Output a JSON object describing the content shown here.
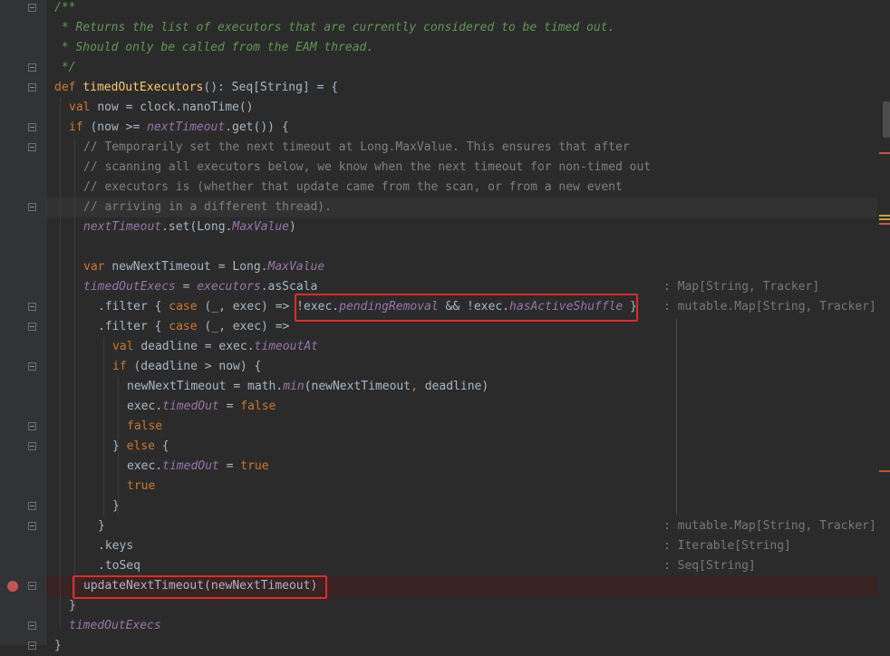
{
  "editor": {
    "language": "Scala",
    "accent_colors": {
      "breakpoint": "#c75450",
      "highlight_box": "#e02b2b",
      "keyword": "#cc7832",
      "function": "#ffc66d",
      "field": "#9876aa",
      "comment": "#808080",
      "doc_comment": "#629755"
    }
  },
  "lines": [
    {
      "tokens": [
        [
          "c-com",
          "/**"
        ]
      ]
    },
    {
      "tokens": [
        [
          "c-com",
          " * Returns the list of executors that are currently considered to be timed out."
        ]
      ]
    },
    {
      "tokens": [
        [
          "c-com",
          " * Should only be called from the EAM thread."
        ]
      ]
    },
    {
      "tokens": [
        [
          "c-com",
          " */"
        ]
      ]
    },
    {
      "tokens": [
        [
          "kw",
          "def "
        ],
        [
          "fn",
          "timedOutExecutors"
        ],
        [
          "",
          "(): Seq[String] = {"
        ]
      ]
    },
    {
      "tokens": [
        [
          "kw",
          "val "
        ],
        [
          "",
          "now = clock.nanoTime()"
        ]
      ]
    },
    {
      "tokens": [
        [
          "kw",
          "if "
        ],
        [
          "",
          "(now >= "
        ],
        [
          "fld",
          "nextTimeout"
        ],
        [
          "",
          ".get()) {"
        ]
      ]
    },
    {
      "tokens": [
        [
          "c-cmt",
          "// Temporarily set the next timeout at Long.MaxValue. This ensures that after"
        ]
      ]
    },
    {
      "tokens": [
        [
          "c-cmt",
          "// scanning all executors below, we know when the next timeout for non-timed out"
        ]
      ]
    },
    {
      "tokens": [
        [
          "c-cmt",
          "// executors is (whether that update came from the scan, or from a new event"
        ]
      ]
    },
    {
      "tokens": [
        [
          "c-cmt",
          "// arriving in a different thread)."
        ]
      ]
    },
    {
      "tokens": [
        [
          "fld",
          "nextTimeout"
        ],
        [
          "",
          ".set(Long."
        ],
        [
          "fld",
          "MaxValue"
        ],
        [
          "",
          ")"
        ]
      ]
    },
    {
      "tokens": []
    },
    {
      "tokens": [
        [
          "kw",
          "var "
        ],
        [
          "",
          "newNextTimeout = Long."
        ],
        [
          "fld",
          "MaxValue"
        ]
      ]
    },
    {
      "tokens": [
        [
          "fld",
          "timedOutExecs"
        ],
        [
          "",
          " = "
        ],
        [
          "fld",
          "executors"
        ],
        [
          "",
          ".asScala"
        ]
      ]
    },
    {
      "tokens": [
        [
          "",
          ".filter { "
        ],
        [
          "kw",
          "case "
        ],
        [
          "",
          "(_, exec) => "
        ],
        [
          "",
          "!exec."
        ],
        [
          "fld",
          "pendingRemoval"
        ],
        [
          "",
          " && !exec."
        ],
        [
          "fld",
          "hasActiveShuffle"
        ],
        [
          "",
          " }"
        ]
      ]
    },
    {
      "tokens": [
        [
          "",
          ".filter { "
        ],
        [
          "kw",
          "case "
        ],
        [
          "",
          "(_, exec) =>"
        ]
      ]
    },
    {
      "tokens": [
        [
          "kw",
          "val "
        ],
        [
          "",
          "deadline = exec."
        ],
        [
          "fld",
          "timeoutAt"
        ]
      ]
    },
    {
      "tokens": [
        [
          "kw",
          "if "
        ],
        [
          "",
          "(deadline > now) {"
        ]
      ]
    },
    {
      "tokens": [
        [
          "",
          "newNextTimeout = math."
        ],
        [
          "fld",
          "min"
        ],
        [
          "",
          "(newNextTimeout"
        ],
        [
          "kw",
          ", "
        ],
        [
          "",
          "deadline)"
        ]
      ]
    },
    {
      "tokens": [
        [
          "",
          "exec."
        ],
        [
          "fld",
          "timedOut"
        ],
        [
          "",
          " = "
        ],
        [
          "kw",
          "false"
        ]
      ]
    },
    {
      "tokens": [
        [
          "kw",
          "false"
        ]
      ]
    },
    {
      "tokens": [
        [
          "",
          "} "
        ],
        [
          "kw",
          "else "
        ],
        [
          "",
          "{"
        ]
      ]
    },
    {
      "tokens": [
        [
          "",
          "exec."
        ],
        [
          "fld",
          "timedOut"
        ],
        [
          "",
          " = "
        ],
        [
          "kw",
          "true"
        ]
      ]
    },
    {
      "tokens": [
        [
          "kw",
          "true"
        ]
      ]
    },
    {
      "tokens": [
        [
          "",
          "}"
        ]
      ]
    },
    {
      "tokens": [
        [
          "",
          "}"
        ]
      ]
    },
    {
      "tokens": [
        [
          "",
          ".keys"
        ]
      ]
    },
    {
      "tokens": [
        [
          "",
          ".toSeq"
        ]
      ]
    },
    {
      "tokens": [
        [
          "",
          "updateNextTimeout(newNextTimeout)"
        ]
      ]
    },
    {
      "tokens": [
        [
          "",
          "}"
        ]
      ]
    },
    {
      "tokens": [
        [
          "fld",
          "timedOutExecs"
        ]
      ]
    },
    {
      "tokens": [
        [
          "",
          "}"
        ]
      ]
    }
  ],
  "type_hints": [
    {
      "line": 14,
      "text": ": Map[String, Tracker]"
    },
    {
      "line": 15,
      "text": ": mutable.Map[String, Tracker]"
    },
    {
      "line": 26,
      "text": ": mutable.Map[String, Tracker]"
    },
    {
      "line": 27,
      "text": ": Iterable[String]"
    },
    {
      "line": 28,
      "text": ": Seq[String]"
    }
  ],
  "gutter": {
    "breakpoint_line": 29,
    "fold_markers": [
      0,
      3,
      4,
      6,
      7,
      10,
      15,
      16,
      18,
      21,
      22,
      25,
      26,
      29,
      31,
      32
    ]
  }
}
